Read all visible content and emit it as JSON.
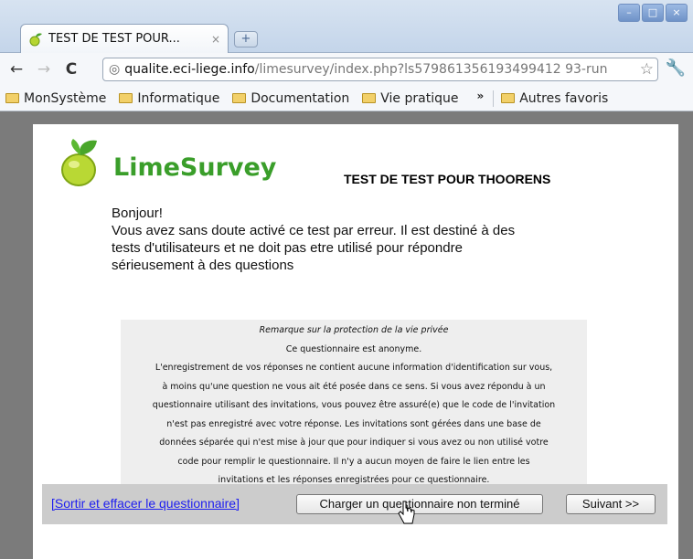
{
  "browser": {
    "tab_title": "TEST DE TEST POUR...",
    "tab_close": "×",
    "new_tab": "+",
    "url_host": "qualite.eci-liege.info",
    "url_path": "/limesurvey/index.php?ls579861356193499412 93-run",
    "window_buttons": [
      "–",
      "□",
      "×"
    ]
  },
  "bookmarks": [
    "MonSystème",
    "Informatique",
    "Documentation",
    "Vie pratique"
  ],
  "bookmarks_more": "»",
  "bookmarks_other": "Autres favoris",
  "survey": {
    "logo_text": "LimeSurvey",
    "title": "TEST DE TEST POUR THOORENS",
    "welcome_line1": "Bonjour!",
    "welcome_line2": "Vous avez sans doute activé ce test par erreur. Il est destiné à des",
    "welcome_line3": "tests d'utilisateurs et ne doit pas etre utilisé pour répondre",
    "welcome_line4": "sérieusement à des questions",
    "privacy_heading": "Remarque sur la protection de la vie privée",
    "privacy_lines": [
      "Ce questionnaire est anonyme.",
      "L'enregistrement de vos réponses ne contient aucune information d'identification sur vous,",
      "à moins qu'une question ne vous ait été posée dans ce sens. Si vous avez répondu à un",
      "questionnaire utilisant des invitations, vous pouvez être assuré(e) que le code de l'invitation",
      "n'est pas enregistré avec votre réponse. Les invitations sont gérées dans une base de",
      "données séparée qui n'est mise à jour que pour indiquer si vous avez ou non utilisé votre",
      "code pour remplir le questionnaire. Il n'y a aucun moyen de faire le lien entre les",
      "invitations et les réponses enregistrées pour ce questionnaire."
    ]
  },
  "nav": {
    "exit_link": "[Sortir et effacer le questionnaire]",
    "load_button": "Charger un questionnaire non terminé",
    "next_button": "Suivant >>"
  },
  "colors": {
    "logo_green": "#3a9e2a",
    "link_blue": "#1d1df0",
    "nav_bg": "#cccccc",
    "privacy_bg": "#eeeeee"
  }
}
